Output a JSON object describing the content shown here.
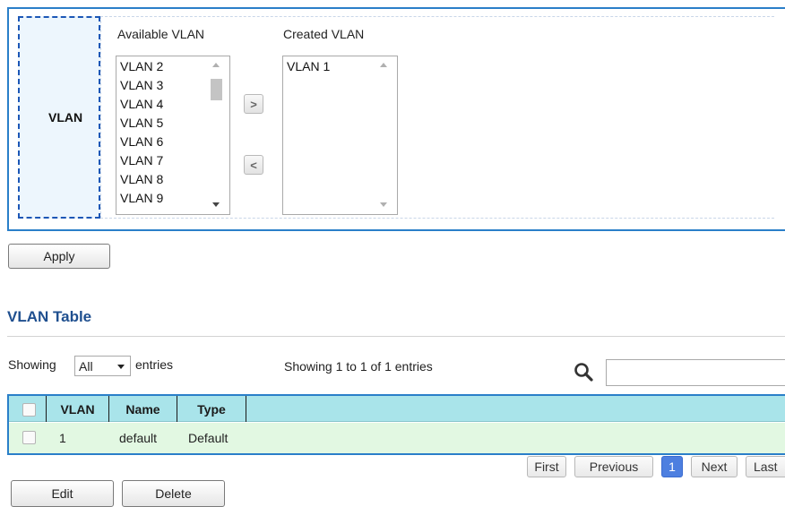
{
  "vlan_form": {
    "label": "VLAN",
    "available_title": "Available VLAN",
    "created_title": "Created VLAN",
    "available_items": [
      "VLAN 2",
      "VLAN 3",
      "VLAN 4",
      "VLAN 5",
      "VLAN 6",
      "VLAN 7",
      "VLAN 8",
      "VLAN 9"
    ],
    "created_items": [
      "VLAN 1"
    ],
    "add_glyph": ">",
    "remove_glyph": "<"
  },
  "apply_label": "Apply",
  "table_section": {
    "title": "VLAN Table",
    "showing_prefix": "Showing",
    "entries_select_value": "All",
    "entries_suffix": "entries",
    "info_text": "Showing 1 to 1 of 1 entries",
    "search_icon": "search-icon",
    "search_value": "",
    "columns": [
      "VLAN",
      "Name",
      "Type"
    ],
    "rows": [
      {
        "vlan": "1",
        "name": "default",
        "type": "Default"
      }
    ],
    "header_color": "#a9e4ea",
    "row_color": "#e2f8e2",
    "accent_color": "#2a7fc9"
  },
  "pagination": {
    "first": "First",
    "previous": "Previous",
    "current_page": "1",
    "next": "Next",
    "last": "Last"
  },
  "actions": {
    "edit": "Edit",
    "delete": "Delete"
  }
}
